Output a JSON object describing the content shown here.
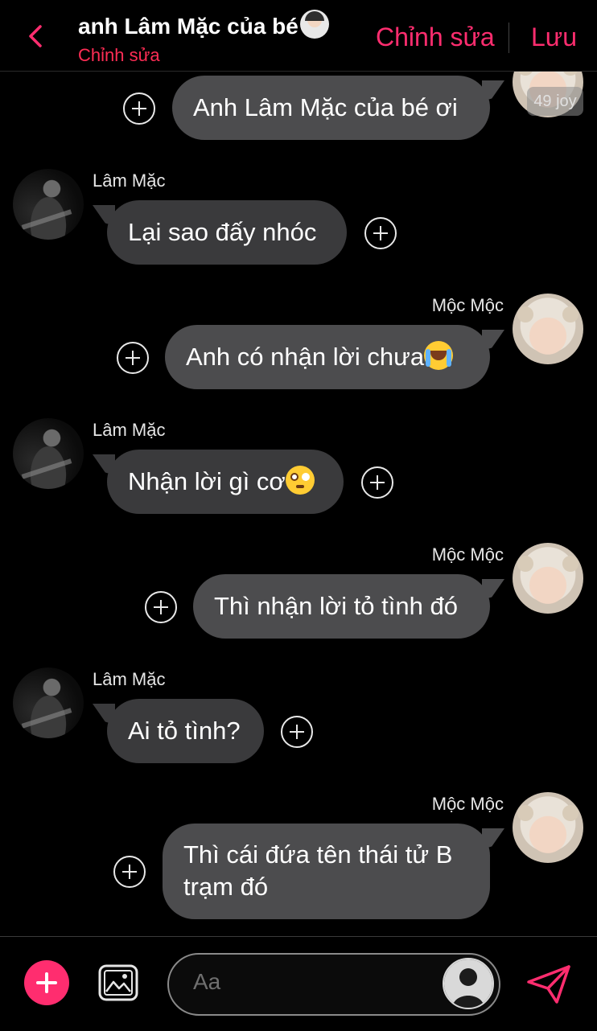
{
  "header": {
    "title": "anh Lâm Mặc của bé",
    "subtitle": "Chỉnh sửa",
    "edit_label": "Chỉnh sửa",
    "save_label": "Lưu",
    "accent": "#ff2d6f",
    "title_emoji_icon": "person-emoji-icon"
  },
  "badge_text": "49 joy",
  "messages": [
    {
      "side": "right",
      "text": "Anh Lâm Mặc của bé ơi"
    },
    {
      "side": "left",
      "sender": "Lâm Mặc",
      "text": "Lại sao đấy nhóc"
    },
    {
      "side": "right",
      "sender": "Mộc Mộc",
      "text": "Anh có nhận lời chưa",
      "emoji": "crying-face-icon"
    },
    {
      "side": "left",
      "sender": "Lâm Mặc",
      "text": "Nhận lời gì cơ",
      "emoji": "flushed-face-icon"
    },
    {
      "side": "right",
      "sender": "Mộc Mộc",
      "text": "Thì nhận lời tỏ tình đó"
    },
    {
      "side": "left",
      "sender": "Lâm Mặc",
      "text": "Ai tỏ tình?"
    },
    {
      "side": "right",
      "sender": "Mộc Mộc",
      "text_line1": "Thì cái đứa tên thái tử B",
      "text_line2": "trạm đó"
    }
  ],
  "composer": {
    "placeholder": "Aa"
  },
  "colors": {
    "bubble_left": "#3a3a3c",
    "bubble_right": "#4c4c4e",
    "subtitle": "#ff2d55"
  }
}
